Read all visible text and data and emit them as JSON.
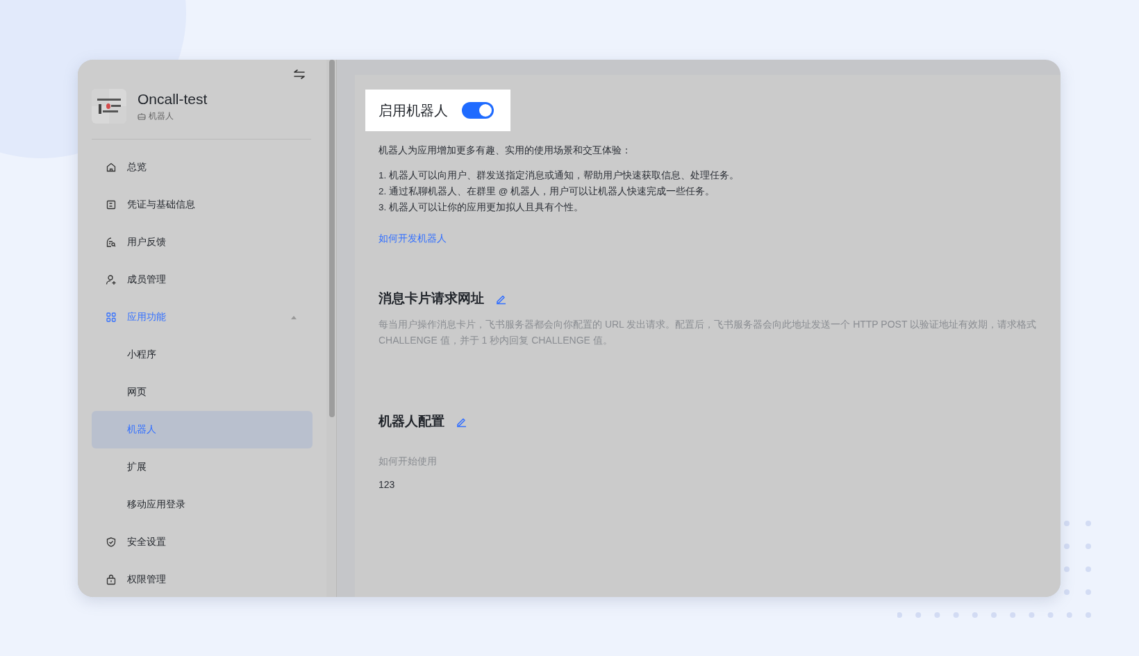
{
  "app": {
    "name": "Oncall-test",
    "type": "机器人"
  },
  "sidebar": {
    "items": [
      {
        "label": "总览",
        "kind": "home",
        "selected": false
      },
      {
        "label": "凭证与基础信息",
        "kind": "doc",
        "selected": false
      },
      {
        "label": "用户反馈",
        "kind": "feedback",
        "selected": false
      },
      {
        "label": "成员管理",
        "kind": "member",
        "selected": false
      },
      {
        "label": "应用功能",
        "kind": "grid",
        "selected": true,
        "expanded": true,
        "children": [
          {
            "label": "小程序",
            "selected": false
          },
          {
            "label": "网页",
            "selected": false
          },
          {
            "label": "机器人",
            "selected": true
          },
          {
            "label": "扩展",
            "selected": false
          },
          {
            "label": "移动应用登录",
            "selected": false
          }
        ]
      },
      {
        "label": "安全设置",
        "kind": "shield",
        "selected": false
      },
      {
        "label": "权限管理",
        "kind": "lock",
        "selected": false
      }
    ]
  },
  "enable": {
    "label": "启用机器人",
    "on": true
  },
  "intro": "机器人为应用增加更多有趣、实用的使用场景和交互体验：",
  "features": [
    "1. 机器人可以向用户、群发送指定消息或通知，帮助用户快速获取信息、处理任务。",
    "2. 通过私聊机器人、在群里 @ 机器人，用户可以让机器人快速完成一些任务。",
    "3. 机器人可以让你的应用更加拟人且具有个性。"
  ],
  "guide_link": "如何开发机器人",
  "card_url_section": {
    "title": "消息卡片请求网址",
    "lines": [
      "每当用户操作消息卡片，飞书服务器都会向你配置的 URL 发出请求。配置后，飞书服务器会向此地址发送一个 HTTP POST 以验证地址有效期，请求格式",
      "CHALLENGE 值，并于 1 秒内回复 CHALLENGE 值。"
    ]
  },
  "config_section": {
    "title": "机器人配置",
    "field": {
      "label": "如何开始使用",
      "value": "123"
    }
  }
}
